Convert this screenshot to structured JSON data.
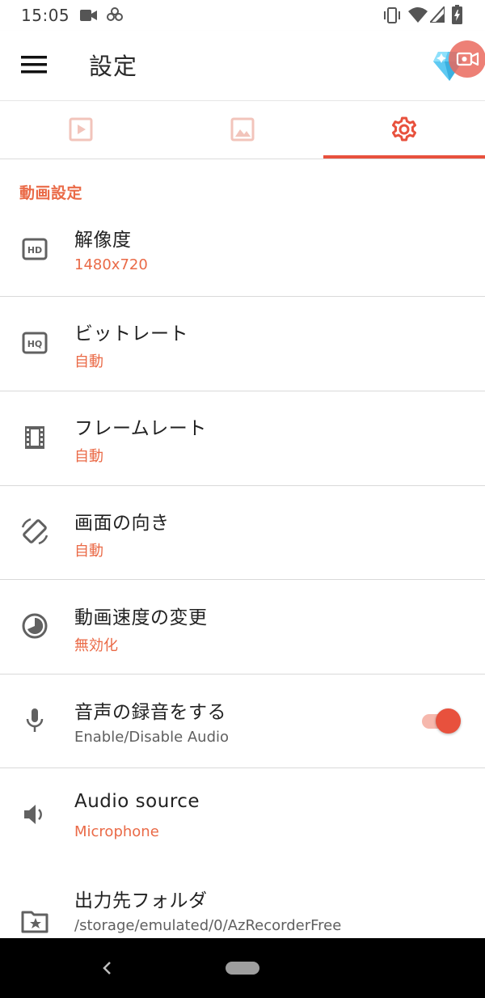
{
  "status_bar": {
    "time": "15:05",
    "icons": [
      "video-camera-icon",
      "pinwheel-icon",
      "vibrate-icon",
      "wifi-icon",
      "cell-signal-icon",
      "battery-charging-icon"
    ]
  },
  "app_bar": {
    "title": "設定",
    "menu_icon": "hamburger-menu-icon",
    "premium_icon": "diamond-icon"
  },
  "tabs": [
    {
      "icon": "video-play-icon",
      "selected": false
    },
    {
      "icon": "image-icon",
      "selected": false
    },
    {
      "icon": "gear-icon",
      "selected": true
    }
  ],
  "colors": {
    "accent": "#e8513d",
    "accent_text": "#ea6a47",
    "tab_inactive": "#f2c4bb"
  },
  "section": {
    "header": "動画設定"
  },
  "settings": [
    {
      "icon": "hd-icon",
      "title": "解像度",
      "value": "1480x720"
    },
    {
      "icon": "hq-icon",
      "title": "ビットレート",
      "value": "自動"
    },
    {
      "icon": "film-strip-icon",
      "title": "フレームレート",
      "value": "自動"
    },
    {
      "icon": "screen-rotation-icon",
      "title": "画面の向き",
      "value": "自動"
    },
    {
      "icon": "speed-contrast-icon",
      "title": "動画速度の変更",
      "value": "無効化"
    },
    {
      "icon": "microphone-icon",
      "title": "音声の録音をする",
      "value": "Enable/Disable Audio",
      "toggle_on": true
    },
    {
      "icon": "speaker-icon",
      "title": "Audio source",
      "value": "Microphone"
    },
    {
      "icon": "folder-star-icon",
      "title": "出力先フォルダ",
      "value": "/storage/emulated/0/AzRecorderFree"
    }
  ],
  "nav_bar": {
    "back_icon": "back-chevron-icon",
    "home_icon": "home-pill-icon"
  }
}
